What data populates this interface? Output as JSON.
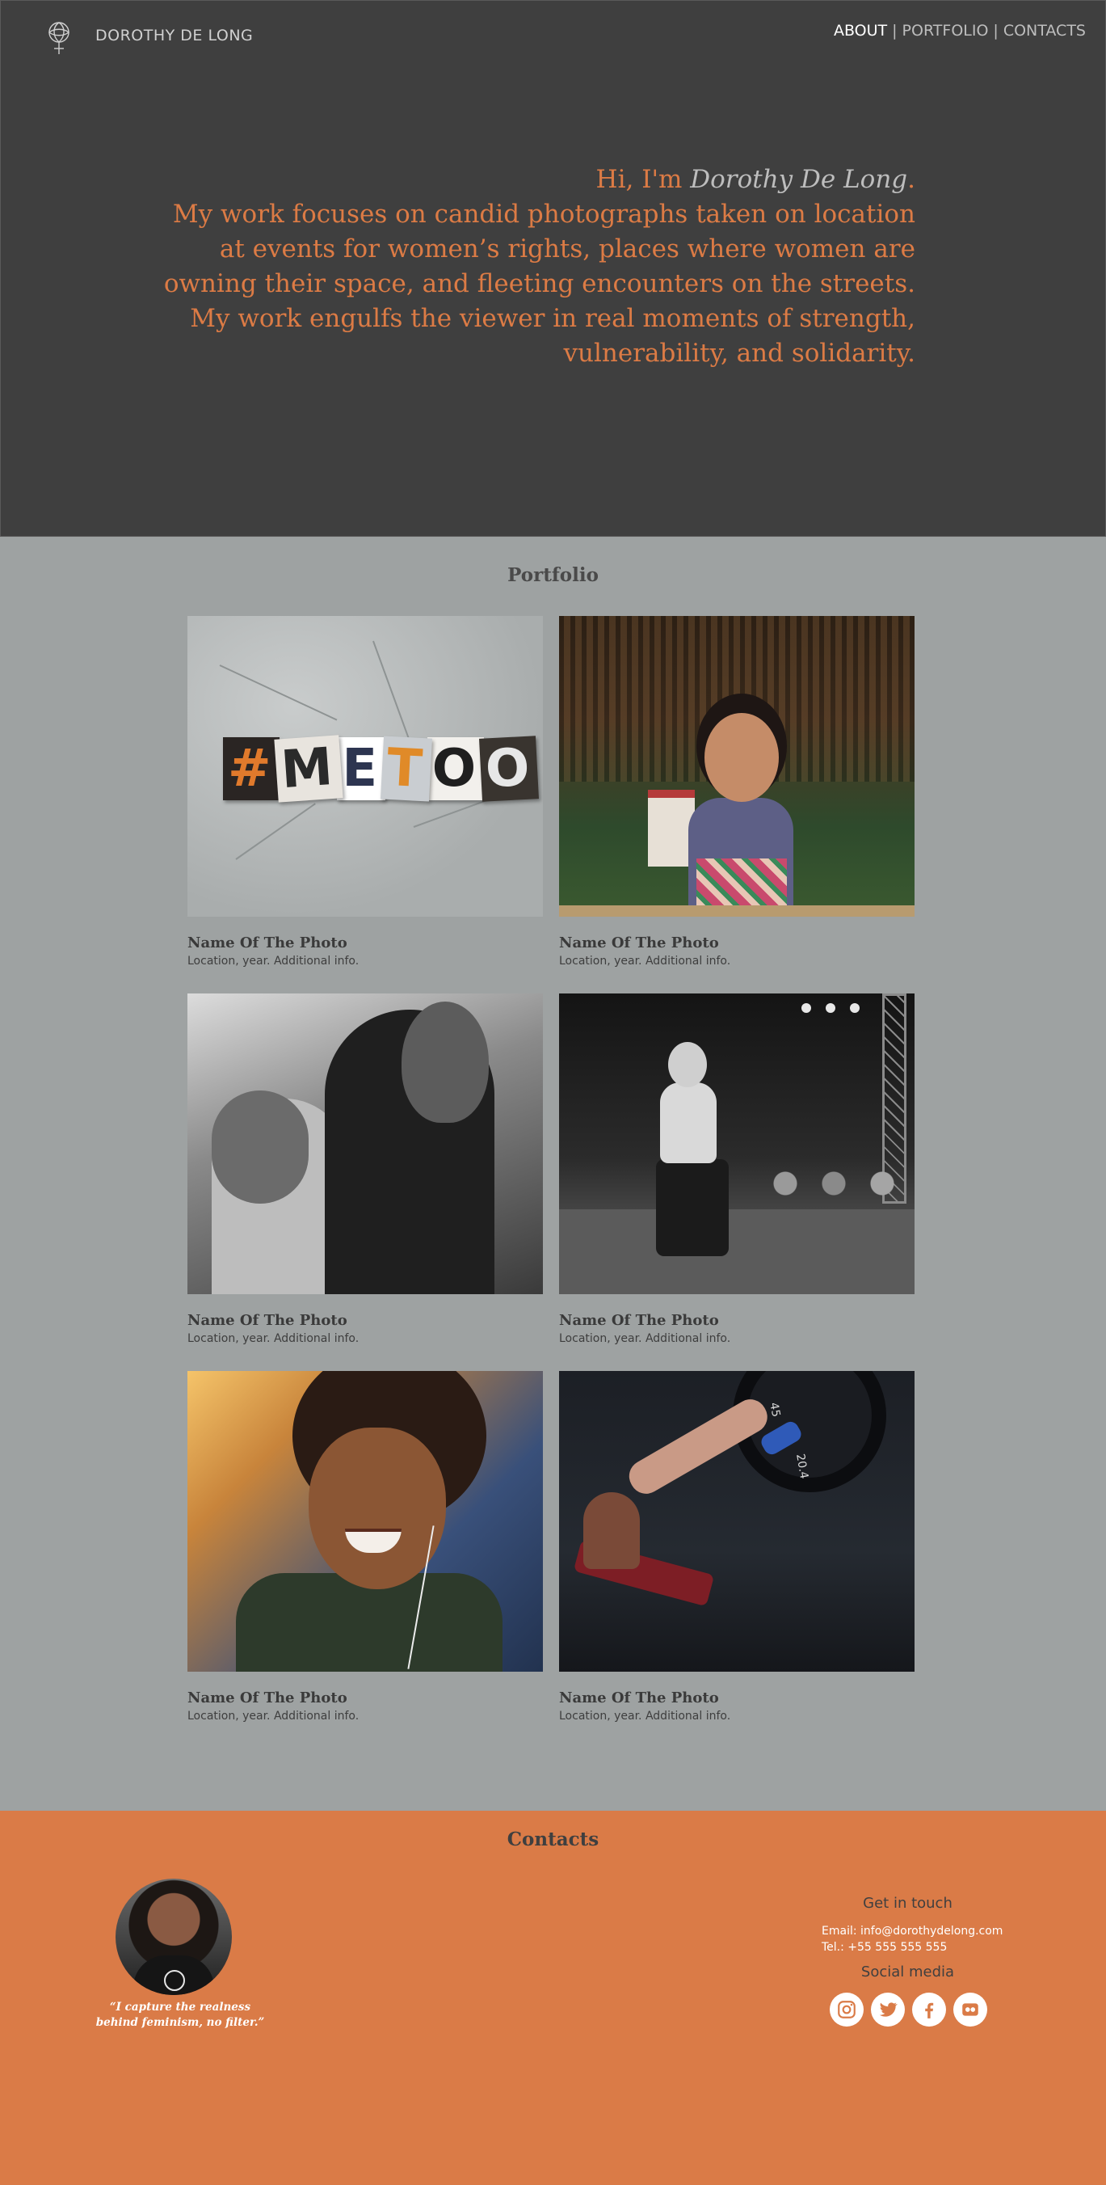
{
  "header": {
    "brand": "DOROTHY DE LONG",
    "nav": [
      {
        "label": "ABOUT",
        "active": true
      },
      {
        "label": "PORTFOLIO",
        "active": false
      },
      {
        "label": "CONTACTS",
        "active": false
      }
    ],
    "separator": "|",
    "logo_icon": "female-symbol-flower-icon"
  },
  "intro": {
    "greeting_prefix": "Hi, I'm ",
    "name": "Dorothy De Long",
    "greeting_suffix": ".",
    "lines": [
      "My work focuses on candid photographs taken on location",
      "at events for women’s rights, places where women are",
      "owning their space, and fleeting encounters on the streets.",
      "My work engulfs the viewer in real moments of strength,",
      "vulnerability, and solidarity."
    ]
  },
  "portfolio": {
    "title": "Portfolio",
    "items": [
      {
        "title": "Name Of The Photo",
        "subtitle": "Location, year. Additional info.",
        "photo_text": [
          "#",
          "M",
          "E",
          "T",
          "O",
          "O"
        ]
      },
      {
        "title": "Name Of The Photo",
        "subtitle": "Location, year. Additional info."
      },
      {
        "title": "Name Of The Photo",
        "subtitle": "Location, year. Additional info."
      },
      {
        "title": "Name Of The Photo",
        "subtitle": "Location, year. Additional info."
      },
      {
        "title": "Name Of The Photo",
        "subtitle": "Location, year. Additional info."
      },
      {
        "title": "Name Of The Photo",
        "subtitle": "Location, year. Additional info.",
        "photo_text": [
          "45",
          "20.4"
        ]
      }
    ]
  },
  "contacts": {
    "title": "Contacts",
    "quote_line1": "“I capture the realness",
    "quote_line2": "behind feminism, no filter.”",
    "get_in_touch": "Get in touch",
    "email": "Email: info@dorothydelong.com",
    "tel": "Tel.: +55 555 555 555",
    "social_title": "Social media",
    "social": [
      "instagram-icon",
      "twitter-icon",
      "facebook-icon",
      "flickr-icon"
    ]
  },
  "colors": {
    "dark": "#3f3f3f",
    "accent": "#dc7b45",
    "gray": "#9ea2a2",
    "footer": "#da7b47"
  }
}
